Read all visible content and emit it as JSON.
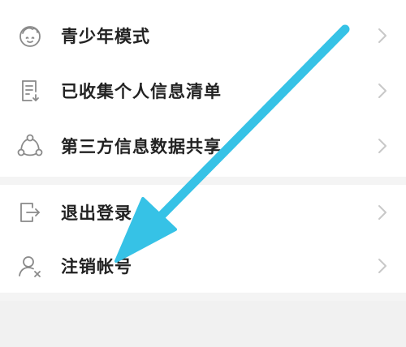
{
  "menu_group_1": {
    "items": [
      {
        "label": "青少年模式",
        "icon": "teen-face-icon"
      },
      {
        "label": "已收集个人信息清单",
        "icon": "document-list-icon"
      },
      {
        "label": "第三方信息数据共享",
        "icon": "share-nodes-icon"
      }
    ]
  },
  "menu_group_2": {
    "items": [
      {
        "label": "退出登录",
        "icon": "logout-icon"
      },
      {
        "label": "注销帐号",
        "icon": "delete-account-icon"
      }
    ]
  },
  "annotation": {
    "arrow_color": "#36c2e6",
    "points_to": "注销帐号"
  },
  "colors": {
    "background": "#f4f4f4",
    "row_background": "#ffffff",
    "text": "#222222",
    "icon": "#8a8a8a",
    "chevron": "#c8c8c8"
  }
}
